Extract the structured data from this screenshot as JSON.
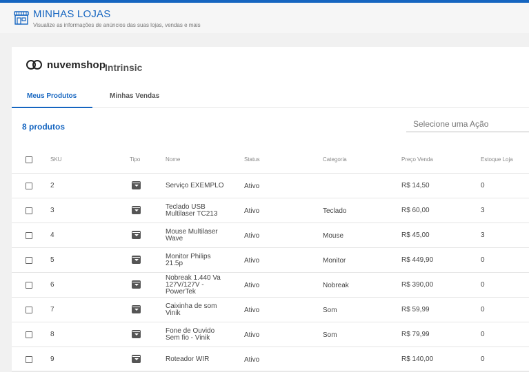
{
  "header": {
    "title": "MINHAS LOJAS",
    "subtitle": "Visualize as informações de anúncios das suas lojas, vendas e mais"
  },
  "store": {
    "brand": "nuvemshop",
    "name": "Intrinsic"
  },
  "tabs": [
    {
      "label": "Meus Produtos",
      "active": true
    },
    {
      "label": "Minhas Vendas",
      "active": false
    }
  ],
  "products_count": "8 produtos",
  "action_select": {
    "placeholder": "Selecione uma Ação"
  },
  "table": {
    "columns": [
      "SKU",
      "Tipo",
      "Nome",
      "Status",
      "Categoria",
      "Preço Venda",
      "Estoque Loja"
    ],
    "rows": [
      {
        "sku": "2",
        "name": [
          "Serviço EXEMPLO"
        ],
        "status": "Ativo",
        "category": "",
        "price": "R$ 14,50",
        "stock": "0"
      },
      {
        "sku": "3",
        "name": [
          "Teclado USB",
          "Multilaser TC213"
        ],
        "status": "Ativo",
        "category": "Teclado",
        "price": "R$ 60,00",
        "stock": "3"
      },
      {
        "sku": "4",
        "name": [
          "Mouse Multilaser",
          "Wave"
        ],
        "status": "Ativo",
        "category": "Mouse",
        "price": "R$ 45,00",
        "stock": "3"
      },
      {
        "sku": "5",
        "name": [
          "Monitor Philips",
          "21.5p"
        ],
        "status": "Ativo",
        "category": "Monitor",
        "price": "R$ 449,90",
        "stock": "0"
      },
      {
        "sku": "6",
        "name": [
          "Nobreak 1.440 Va",
          "127V/127V -",
          "PowerTek"
        ],
        "status": "Ativo",
        "category": "Nobreak",
        "price": "R$ 390,00",
        "stock": "0"
      },
      {
        "sku": "7",
        "name": [
          "Caixinha de som",
          "Vinik"
        ],
        "status": "Ativo",
        "category": "Som",
        "price": "R$ 59,99",
        "stock": "0"
      },
      {
        "sku": "8",
        "name": [
          "Fone de Ouvido",
          "Sem fio - Vinik"
        ],
        "status": "Ativo",
        "category": "Som",
        "price": "R$ 79,99",
        "stock": "0"
      },
      {
        "sku": "9",
        "name": [
          "Roteador WIR"
        ],
        "status": "Ativo",
        "category": "",
        "price": "R$ 140,00",
        "stock": "0"
      }
    ]
  },
  "colors": {
    "accent": "#1565c0"
  },
  "icons": {
    "header": "store-icon",
    "brand": "nuvemshop-logo-icon",
    "type": "product-box-icon"
  }
}
